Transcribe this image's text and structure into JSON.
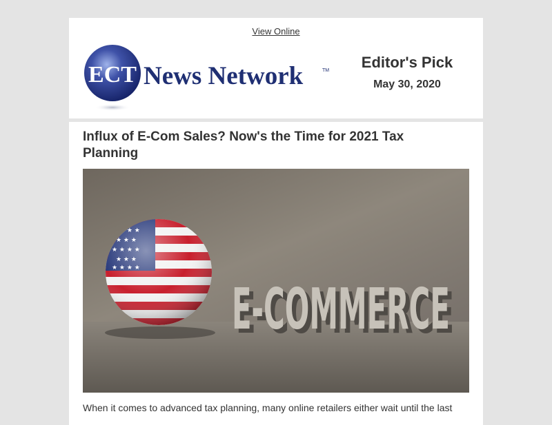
{
  "header": {
    "view_online": "View Online",
    "logo_ect": "ECT",
    "logo_name": "News Network",
    "logo_tm": "TM",
    "editors_pick": "Editor's Pick",
    "date": "May 30, 2020"
  },
  "article": {
    "title": "Influx of E-Com Sales? Now's the Time for 2021 Tax Planning",
    "image_text": "E-COMMERCE",
    "teaser": "When it comes to advanced tax planning, many online retailers either wait until the last"
  },
  "colors": {
    "brand_blue": "#1f2f73",
    "page_bg": "#e4e4e4",
    "text": "#333333"
  }
}
